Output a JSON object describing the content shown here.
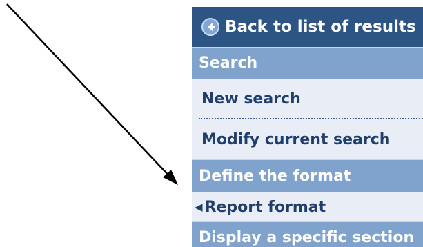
{
  "menu": {
    "back_label": "Back to list of results",
    "back_icon": "back-arrow-icon",
    "sections": [
      {
        "label": "Search"
      },
      {
        "label": "Define the format"
      },
      {
        "label": "Display a specific section"
      }
    ],
    "search_items": [
      {
        "label": "New search"
      },
      {
        "label": "Modify current search"
      }
    ],
    "format_items": [
      {
        "label": "Report format",
        "selected": true
      }
    ]
  },
  "colors": {
    "back_bg": "#2c5484",
    "section_bg": "#7fa3cd",
    "item_bg": "#e9eef6",
    "item_text": "#1f3e6b"
  }
}
